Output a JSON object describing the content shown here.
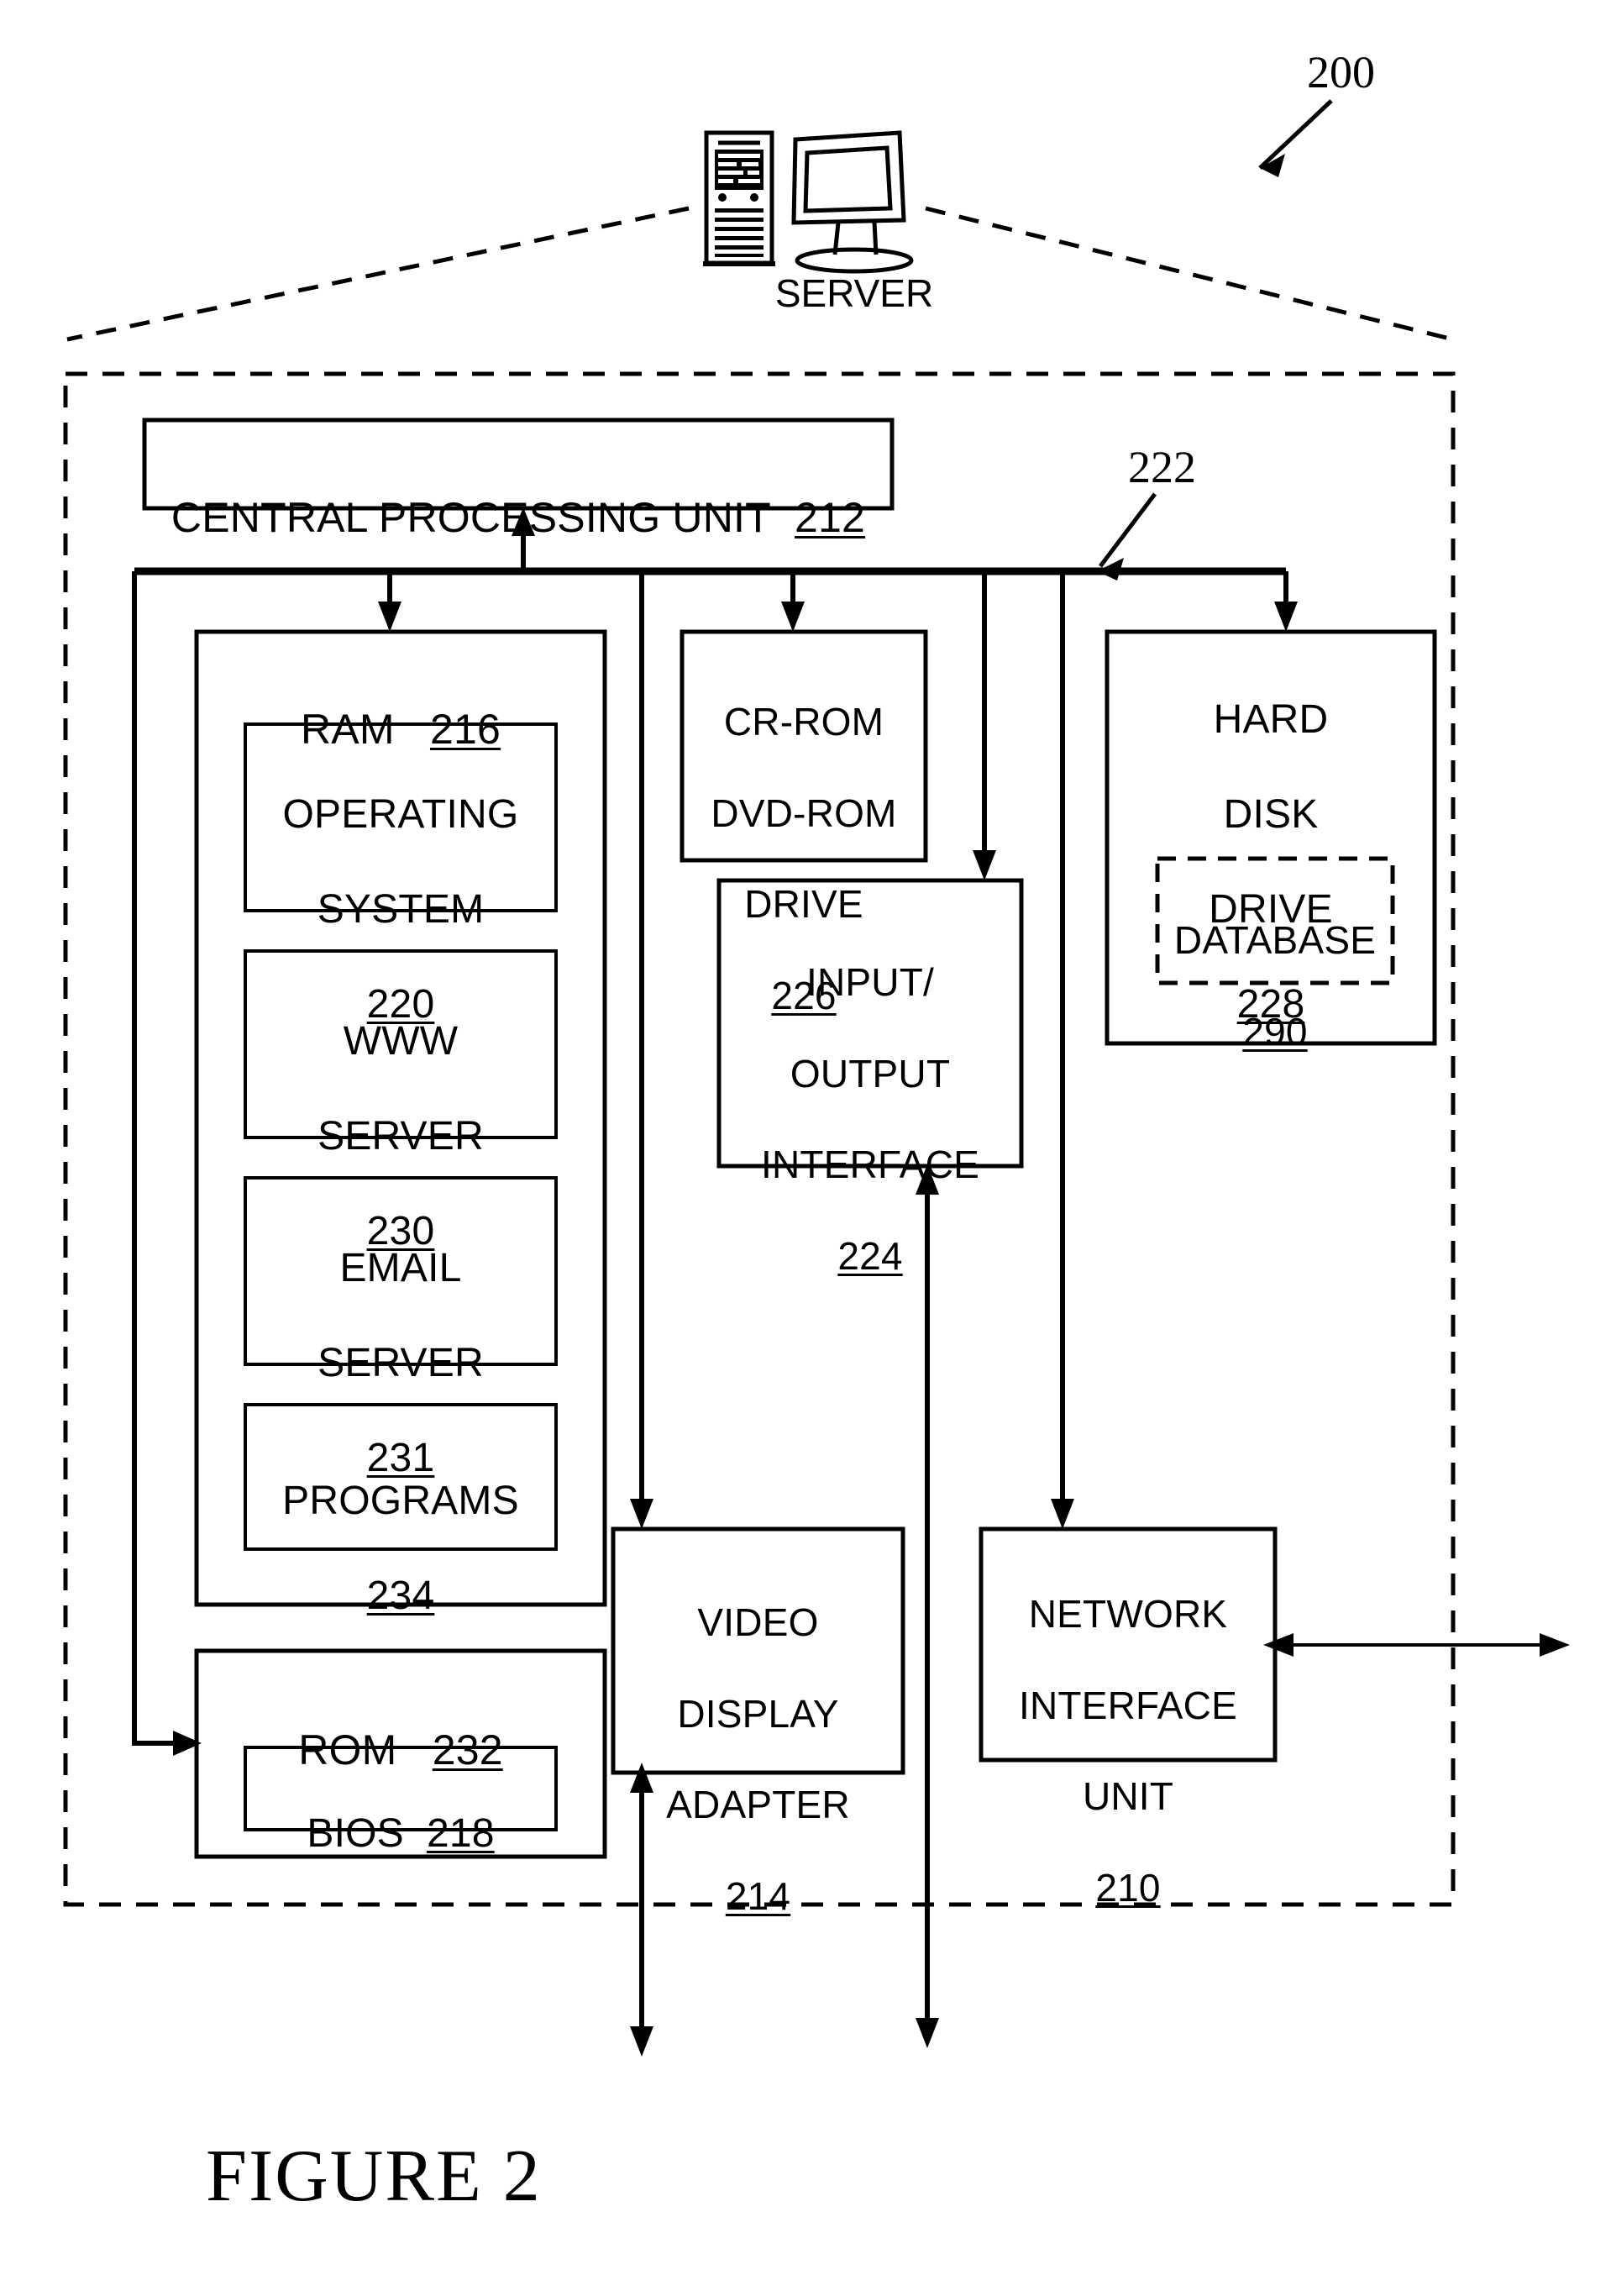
{
  "figure": {
    "caption": "FIGURE 2",
    "system_ref": "200",
    "bus_ref": "222"
  },
  "server_icon": {
    "label": "SERVER",
    "name": "server-computer-icon"
  },
  "blocks": {
    "cpu": {
      "title": "CENTRAL PROCESSING UNIT",
      "ref": "212"
    },
    "ram": {
      "title": "RAM",
      "ref": "216"
    },
    "operating_system": {
      "line1": "OPERATING",
      "line2": "SYSTEM",
      "ref": "220"
    },
    "www_server": {
      "line1": "WWW",
      "line2": "SERVER",
      "ref": "230"
    },
    "email_server": {
      "line1": "EMAIL",
      "line2": "SERVER",
      "ref": "231"
    },
    "programs": {
      "line1": "PROGRAMS",
      "ref": "234"
    },
    "rom": {
      "title": "ROM",
      "ref": "232"
    },
    "bios": {
      "title": "BIOS",
      "ref": "218"
    },
    "cdrom_drive": {
      "line1": "CR-ROM",
      "line2": "DVD-ROM",
      "line3": "DRIVE",
      "ref": "226"
    },
    "io_interface": {
      "line1": "INPUT/",
      "line2": "OUTPUT",
      "line3": "INTERFACE",
      "ref": "224"
    },
    "hard_disk_drive": {
      "line1": "HARD",
      "line2": "DISK",
      "line3": "DRIVE",
      "ref": "228"
    },
    "database": {
      "line1": "DATABASE",
      "ref": "290"
    },
    "video_display_adapter": {
      "line1": "VIDEO",
      "line2": "DISPLAY",
      "line3": "ADAPTER",
      "ref": "214"
    },
    "network_interface_unit": {
      "line1": "NETWORK",
      "line2": "INTERFACE",
      "line3": "UNIT",
      "ref": "210"
    }
  },
  "colors": {
    "ink": "#000000",
    "paper": "#ffffff"
  }
}
